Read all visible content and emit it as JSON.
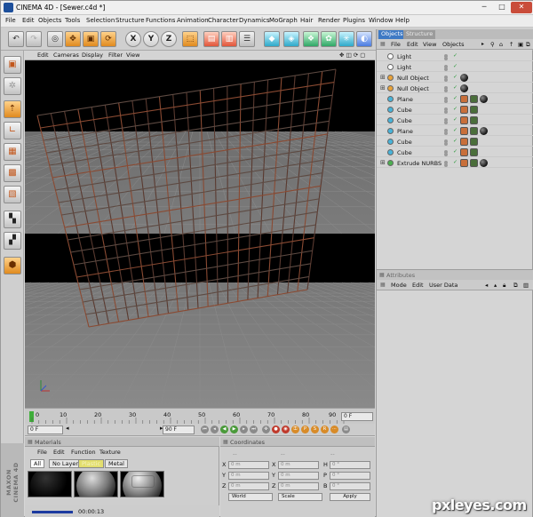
{
  "window": {
    "title": "CINEMA 4D - [Sewer.c4d *]",
    "minimize": "─",
    "maximize": "□",
    "close": "✕"
  },
  "menubar": [
    "File",
    "Edit",
    "Objects",
    "Tools",
    "Selection",
    "Structure",
    "Functions",
    "Animation",
    "Character",
    "Dynamics",
    "MoGraph",
    "Hair",
    "Render",
    "Plugins",
    "Window",
    "Help"
  ],
  "toolbar": {
    "icons": [
      "undo-icon",
      "redo-icon",
      "live-selection-icon",
      "move-icon",
      "scale-icon",
      "rotate-icon",
      "x-axis-icon",
      "y-axis-icon",
      "z-axis-icon",
      "coordinate-system-icon",
      "render-view-icon",
      "render-picture-queue-icon",
      "render-settings-icon",
      "cube-icon",
      "nurbs-icon",
      "array-icon",
      "deformer-icon",
      "scene-icon",
      "light-icon"
    ],
    "axis_labels": {
      "x": "X",
      "y": "Y",
      "z": "Z"
    }
  },
  "viewport": {
    "menu": [
      "Edit",
      "Cameras",
      "Display",
      "Filter",
      "View"
    ],
    "nav_icons": "✥ ◫ ⟳ ▢"
  },
  "timeline": {
    "ticks": [
      "0",
      "10",
      "20",
      "30",
      "40",
      "50",
      "60",
      "70",
      "80",
      "90"
    ],
    "current_frame": "0 F",
    "start_field": "0 F",
    "end_field": "90 F"
  },
  "materials": {
    "title": "Materials",
    "menu": [
      "File",
      "Edit",
      "Function",
      "Texture"
    ],
    "tabs": [
      "All",
      "No Layer",
      "Plastic",
      "Metal"
    ],
    "render_time": "00:00:13",
    "progress_fraction": 0.35
  },
  "coordinates": {
    "title": "Coordinates",
    "rows": [
      {
        "a": "X",
        "av": "0 m",
        "b": "X",
        "bv": "0 m",
        "c": "H",
        "cv": "0 °"
      },
      {
        "a": "Y",
        "av": "0 m",
        "b": "Y",
        "bv": "0 m",
        "c": "P",
        "cv": "0 °"
      },
      {
        "a": "Z",
        "av": "0 m",
        "b": "Z",
        "bv": "0 m",
        "c": "B",
        "cv": "0 °"
      }
    ],
    "headers": [
      "--",
      "--",
      "--"
    ],
    "world_dropdown": "World",
    "scale_dropdown": "Scale",
    "apply_button": "Apply"
  },
  "object_manager": {
    "tabs": [
      "Objects",
      "Structure"
    ],
    "menu": [
      "File",
      "Edit",
      "View",
      "Objects"
    ],
    "objects": [
      {
        "name": "Light",
        "icon": "light-icon"
      },
      {
        "name": "Light",
        "icon": "light-icon"
      },
      {
        "name": "Null Object",
        "icon": "null-icon"
      },
      {
        "name": "Null Object",
        "icon": "null-icon"
      },
      {
        "name": "Plane",
        "icon": "plane-icon"
      },
      {
        "name": "Cube",
        "icon": "cube-icon"
      },
      {
        "name": "Cube",
        "icon": "cube-icon"
      },
      {
        "name": "Plane",
        "icon": "plane-icon"
      },
      {
        "name": "Cube",
        "icon": "cube-icon"
      },
      {
        "name": "Cube",
        "icon": "cube-icon"
      },
      {
        "name": "Extrude NURBS",
        "icon": "extrude-nurbs-icon"
      }
    ]
  },
  "attributes": {
    "title": "Attributes",
    "menu": [
      "Mode",
      "Edit",
      "User Data"
    ]
  },
  "branding": {
    "vertical_logo": "MAXON CINEMA 4D"
  },
  "watermark": "pxleyes.com",
  "colors": {
    "accent": "#3e79c4",
    "viewport_bg": "#000000",
    "floor": "#5a5a5a",
    "grid": "#7a3b2a"
  }
}
